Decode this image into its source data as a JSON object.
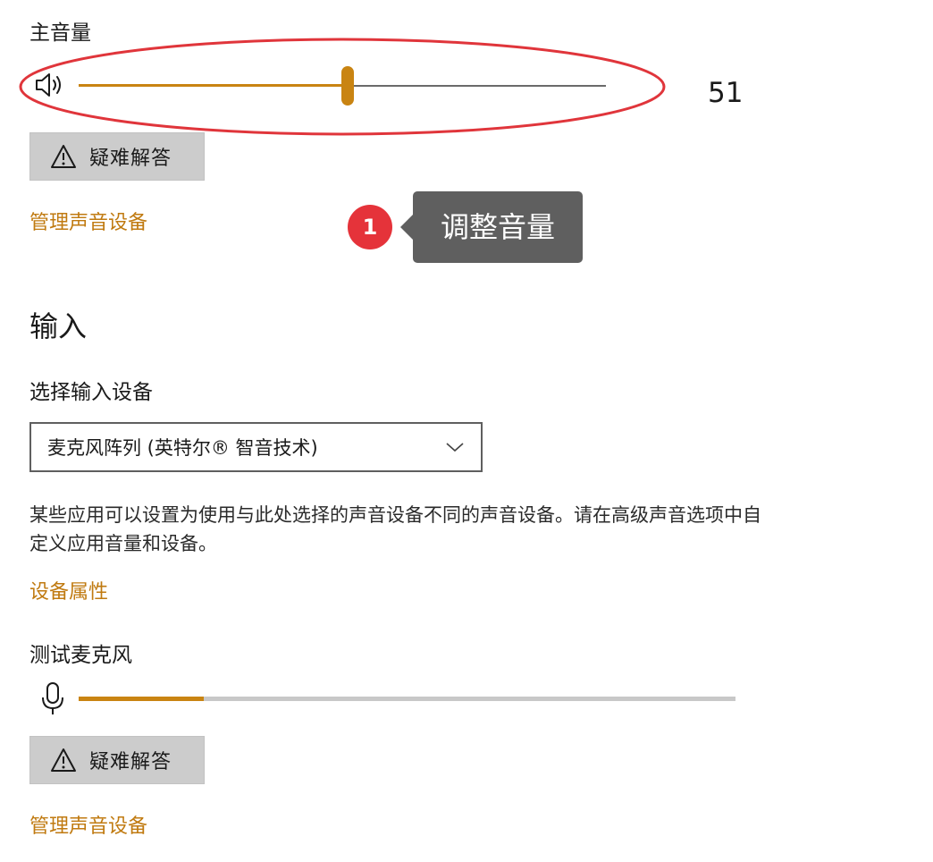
{
  "output": {
    "master_volume_label": "主音量",
    "volume_value": "51",
    "volume_level_percent": 51,
    "troubleshoot_label": "疑难解答",
    "manage_devices_link": "管理声音设备"
  },
  "annotation": {
    "badge_number": "1",
    "callout_text": "调整音量",
    "highlight_color": "#e0353b"
  },
  "input": {
    "section_heading": "输入",
    "choose_device_label": "选择输入设备",
    "selected_device": "麦克风阵列 (英特尔® 智音技术)",
    "description": "某些应用可以设置为使用与此处选择的声音设备不同的声音设备。请在高级声音选项中自定义应用音量和设备。",
    "device_properties_link": "设备属性",
    "test_mic_label": "测试麦克风",
    "mic_level_percent": 19,
    "troubleshoot_label": "疑难解答",
    "manage_devices_link": "管理声音设备"
  },
  "colors": {
    "accent": "#c98412",
    "link": "#c07a10",
    "button_bg": "#cccccc",
    "track_gray": "#c8c8c8"
  },
  "icons": [
    "speaker-icon",
    "warning-icon",
    "chevron-down-icon",
    "microphone-icon"
  ]
}
